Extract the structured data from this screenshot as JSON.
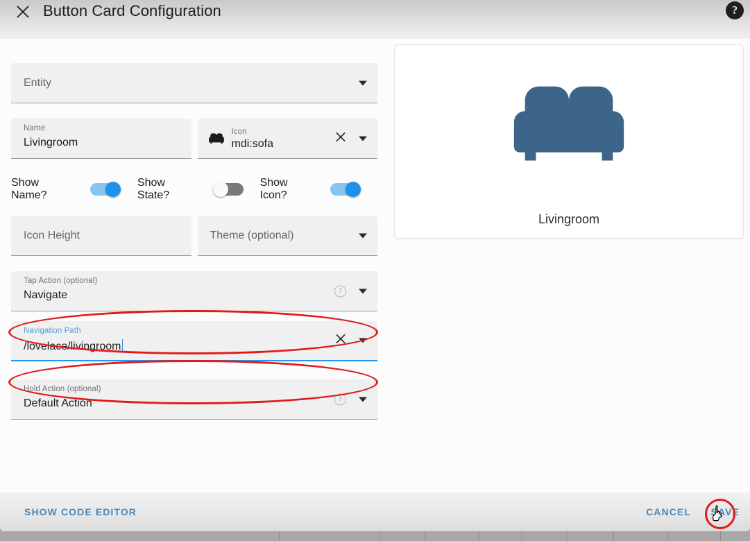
{
  "window": {
    "title": "Button Card Configuration",
    "close_icon": "close-icon",
    "help_icon": "help-circle-icon",
    "help_glyph": "?"
  },
  "form": {
    "entity": {
      "label": "Entity",
      "value": "",
      "placeholder": "Entity",
      "caret_icon": "chevron-down-icon"
    },
    "name": {
      "label": "Name",
      "value": "Livingroom"
    },
    "icon": {
      "label": "Icon",
      "value": "mdi:sofa",
      "glyph_icon": "sofa-icon",
      "clear_icon": "close-icon",
      "caret_icon": "chevron-down-icon"
    },
    "toggles": [
      {
        "label": "Show Name?",
        "state": "on"
      },
      {
        "label": "Show State?",
        "state": "off"
      },
      {
        "label": "Show Icon?",
        "state": "on"
      }
    ],
    "icon_height": {
      "label": "Icon Height",
      "value": "",
      "placeholder": "Icon Height"
    },
    "theme": {
      "label": "Theme (optional)",
      "value": "",
      "placeholder": "Theme (optional)",
      "caret_icon": "chevron-down-icon"
    },
    "tap_action": {
      "label": "Tap Action (optional)",
      "value": "Navigate",
      "help_glyph": "?",
      "caret_icon": "chevron-down-icon"
    },
    "navigation_path": {
      "label": "Navigation Path",
      "value": "/lovelace/livingroom",
      "focused": true,
      "clear_icon": "close-icon",
      "caret_icon": "chevron-down-icon"
    },
    "hold_action": {
      "label": "Hold Action (optional)",
      "value": "Default Action",
      "help_glyph": "?",
      "caret_icon": "chevron-down-icon"
    }
  },
  "preview": {
    "icon_name": "sofa-icon",
    "icon_color": "#3d6589",
    "name": "Livingroom"
  },
  "footer": {
    "show_code_editor": "SHOW CODE EDITOR",
    "cancel": "CANCEL",
    "save": "SAVE"
  },
  "colors": {
    "accent_link": "#4a89b8",
    "toggle_on": "#1e91e8",
    "toggle_on_track": "#86c5f2",
    "toggle_off_track": "#7a7a7a",
    "focus_underline": "#2196f3",
    "annotation": "#e01b1b",
    "field_bg": "#f0f0f0",
    "dialog_bg": "#fcfcfc"
  },
  "annotations": {
    "tap_action_highlight": "ellipse",
    "navigation_path_highlight": "ellipse",
    "save_highlight": "ellipse",
    "cursor": "pointer-hand-cursor"
  }
}
